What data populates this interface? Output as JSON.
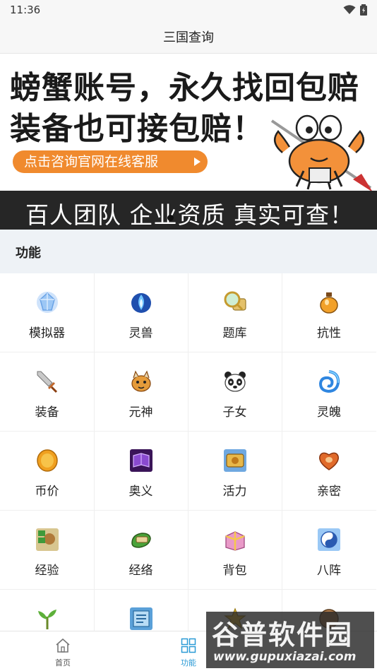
{
  "status_bar": {
    "time": "11:36"
  },
  "nav": {
    "title": "三国查询"
  },
  "banner": {
    "line1": "螃蟹账号，永久找回包赔",
    "line2": "装备也可接包赔！",
    "cta": "点击咨询官网在线客服",
    "strip": "百人团队  企业资质  真实可查！",
    "accent_color": "#f08a2e"
  },
  "section": {
    "title": "功能"
  },
  "features": [
    {
      "label": "模拟器",
      "icon": "crystal-icon"
    },
    {
      "label": "灵兽",
      "icon": "blue-flame-orb-icon"
    },
    {
      "label": "题库",
      "icon": "magnifier-scroll-icon"
    },
    {
      "label": "抗性",
      "icon": "potion-icon"
    },
    {
      "label": "装备",
      "icon": "sword-icon"
    },
    {
      "label": "元神",
      "icon": "beast-icon"
    },
    {
      "label": "子女",
      "icon": "panda-icon"
    },
    {
      "label": "灵魄",
      "icon": "blue-swirl-icon"
    },
    {
      "label": "币价",
      "icon": "gold-coin-icon"
    },
    {
      "label": "奥义",
      "icon": "purple-book-icon"
    },
    {
      "label": "活力",
      "icon": "activity-scroll-icon"
    },
    {
      "label": "亲密",
      "icon": "heart-ornament-icon"
    },
    {
      "label": "经验",
      "icon": "experience-icon"
    },
    {
      "label": "经络",
      "icon": "green-scroll-icon"
    },
    {
      "label": "背包",
      "icon": "gift-box-icon"
    },
    {
      "label": "八阵",
      "icon": "bagua-icon"
    },
    {
      "label": "",
      "icon": "sprout-icon"
    },
    {
      "label": "",
      "icon": "card-icon"
    },
    {
      "label": "",
      "icon": "star-icon"
    },
    {
      "label": "",
      "icon": "item-icon"
    }
  ],
  "tabs": [
    {
      "label": "首页",
      "icon": "home-icon"
    },
    {
      "label": "功能",
      "icon": "grid-icon"
    }
  ],
  "watermark": {
    "title": "谷普软件园",
    "url": "www.gupuxiazai.com"
  }
}
